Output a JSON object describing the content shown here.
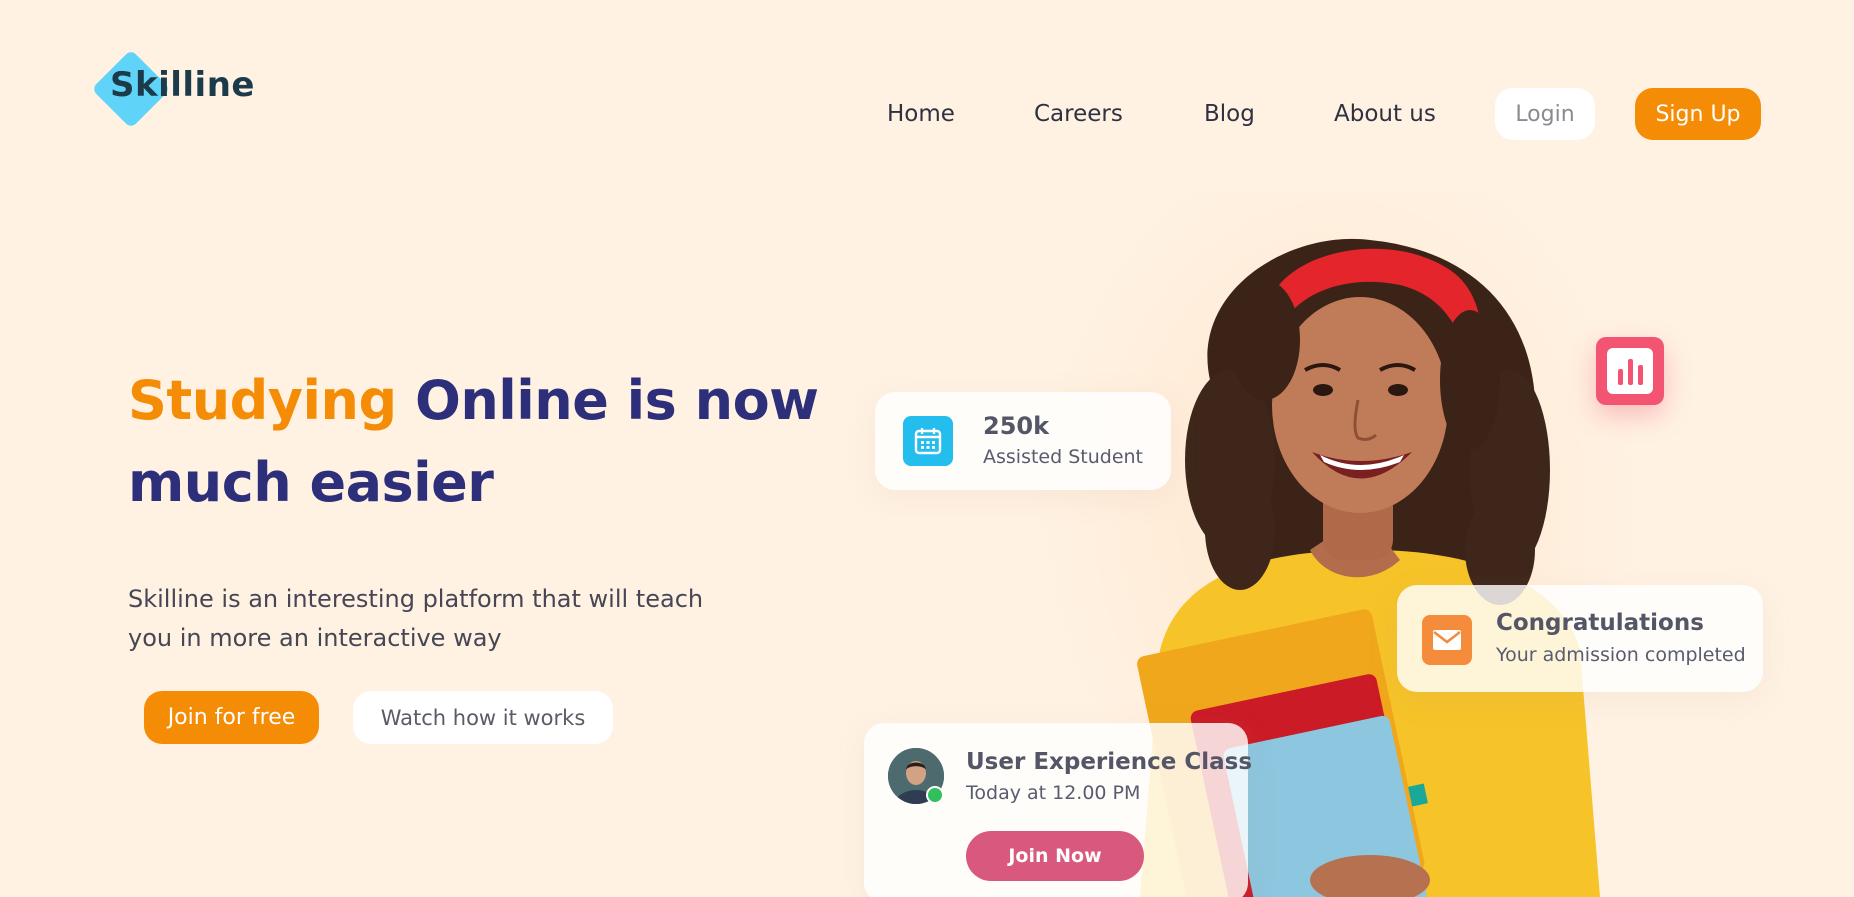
{
  "brand": {
    "name": "Skilline"
  },
  "nav": {
    "items": [
      {
        "label": "Home"
      },
      {
        "label": "Careers"
      },
      {
        "label": "Blog"
      },
      {
        "label": "About us"
      }
    ],
    "login_label": "Login",
    "signup_label": "Sign Up"
  },
  "hero": {
    "title_accent": "Studying",
    "title_rest": "Online is now much easier",
    "description": "Skilline is an interesting platform that will teach you in more an interactive way",
    "join_label": "Join for free",
    "watch_label": "Watch how it works"
  },
  "stats_card": {
    "icon": "calendar-icon",
    "value": "250k",
    "label": "Assisted Student"
  },
  "congrats_card": {
    "icon": "mail-icon",
    "title": "Congratulations",
    "subtitle": "Your admission completed"
  },
  "chart_badge": {
    "icon": "bar-chart-icon"
  },
  "class_card": {
    "title": "User Experience Class",
    "time": "Today at 12.00 PM",
    "join_label": "Join Now",
    "status": "online"
  },
  "colors": {
    "background": "#fff2e3",
    "accent": "#f48c06",
    "heading": "#2d2f7a",
    "cyan": "#23bdee",
    "pink": "#f25471",
    "join_now": "#d8587e",
    "mail_orange": "#f48c3c"
  }
}
